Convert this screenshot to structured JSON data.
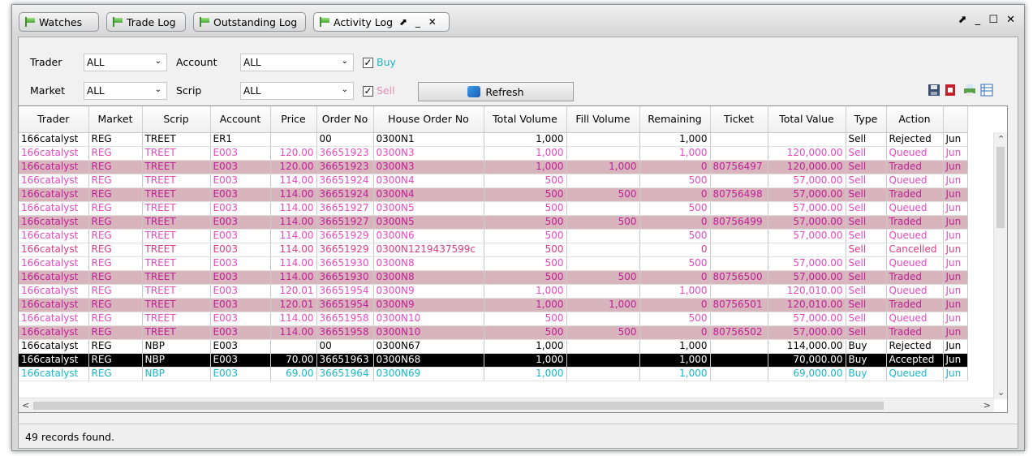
{
  "tabs": [
    {
      "label": "Watches"
    },
    {
      "label": "Trade Log"
    },
    {
      "label": "Outstanding Log"
    },
    {
      "label": "Activity Log"
    }
  ],
  "tab_controls": "⬈ _ ✕",
  "window_controls": "⬈ _ ☐ ✕",
  "filters": {
    "trader_label": "Trader",
    "trader_value": "ALL",
    "account_label": "Account",
    "account_value": "ALL",
    "market_label": "Market",
    "market_value": "ALL",
    "scrip_label": "Scrip",
    "scrip_value": "ALL",
    "buy_label": "Buy",
    "buy_checked": "✓",
    "sell_label": "Sell",
    "sell_checked": "✓",
    "refresh_label": "Refresh"
  },
  "grid": {
    "columns": [
      "Trader",
      "Market",
      "Scrip",
      "Account",
      "Price",
      "Order No",
      "House Order No",
      "Total Volume",
      "Fill Volume",
      "Remaining",
      "Ticket",
      "Total Value",
      "Type",
      "Action",
      ""
    ],
    "rows": [
      {
        "s": "rej",
        "c": [
          "166catalyst",
          "REG",
          "TREET",
          "ER1",
          "",
          "00",
          "0300N1",
          "1,000",
          "",
          "1,000",
          "",
          "",
          "Sell",
          "Rejected",
          "Jun"
        ]
      },
      {
        "s": "que",
        "c": [
          "166catalyst",
          "REG",
          "TREET",
          "E003",
          "120.00",
          "36651923",
          "0300N3",
          "1,000",
          "",
          "1,000",
          "",
          "120,000.00",
          "Sell",
          "Queued",
          "Jun"
        ]
      },
      {
        "s": "tra",
        "c": [
          "166catalyst",
          "REG",
          "TREET",
          "E003",
          "120.00",
          "36651923",
          "0300N3",
          "1,000",
          "1,000",
          "0",
          "80756497",
          "120,000.00",
          "Sell",
          "Traded",
          "Jun"
        ]
      },
      {
        "s": "que",
        "c": [
          "166catalyst",
          "REG",
          "TREET",
          "E003",
          "114.00",
          "36651924",
          "0300N4",
          "500",
          "",
          "500",
          "",
          "57,000.00",
          "Sell",
          "Queued",
          "Jun"
        ]
      },
      {
        "s": "tra",
        "c": [
          "166catalyst",
          "REG",
          "TREET",
          "E003",
          "114.00",
          "36651924",
          "0300N4",
          "500",
          "500",
          "0",
          "80756498",
          "57,000.00",
          "Sell",
          "Traded",
          "Jun"
        ]
      },
      {
        "s": "que",
        "c": [
          "166catalyst",
          "REG",
          "TREET",
          "E003",
          "114.00",
          "36651927",
          "0300N5",
          "500",
          "",
          "500",
          "",
          "57,000.00",
          "Sell",
          "Queued",
          "Jun"
        ]
      },
      {
        "s": "tra",
        "c": [
          "166catalyst",
          "REG",
          "TREET",
          "E003",
          "114.00",
          "36651927",
          "0300N5",
          "500",
          "500",
          "0",
          "80756499",
          "57,000.00",
          "Sell",
          "Traded",
          "Jun"
        ]
      },
      {
        "s": "que",
        "c": [
          "166catalyst",
          "REG",
          "TREET",
          "E003",
          "114.00",
          "36651929",
          "0300N6",
          "500",
          "",
          "500",
          "",
          "57,000.00",
          "Sell",
          "Queued",
          "Jun"
        ]
      },
      {
        "s": "can",
        "c": [
          "166catalyst",
          "REG",
          "TREET",
          "E003",
          "114.00",
          "36651929",
          "0300N1219437599c",
          "500",
          "",
          "0",
          "",
          "",
          "Sell",
          "Cancelled",
          "Jun"
        ]
      },
      {
        "s": "que",
        "c": [
          "166catalyst",
          "REG",
          "TREET",
          "E003",
          "114.00",
          "36651930",
          "0300N8",
          "500",
          "",
          "500",
          "",
          "57,000.00",
          "Sell",
          "Queued",
          "Jun"
        ]
      },
      {
        "s": "tra",
        "c": [
          "166catalyst",
          "REG",
          "TREET",
          "E003",
          "114.00",
          "36651930",
          "0300N8",
          "500",
          "500",
          "0",
          "80756500",
          "57,000.00",
          "Sell",
          "Traded",
          "Jun"
        ]
      },
      {
        "s": "que",
        "c": [
          "166catalyst",
          "REG",
          "TREET",
          "E003",
          "120.01",
          "36651954",
          "0300N9",
          "1,000",
          "",
          "1,000",
          "",
          "120,010.00",
          "Sell",
          "Queued",
          "Jun"
        ]
      },
      {
        "s": "tra",
        "c": [
          "166catalyst",
          "REG",
          "TREET",
          "E003",
          "120.01",
          "36651954",
          "0300N9",
          "1,000",
          "1,000",
          "0",
          "80756501",
          "120,010.00",
          "Sell",
          "Traded",
          "Jun"
        ]
      },
      {
        "s": "que",
        "c": [
          "166catalyst",
          "REG",
          "TREET",
          "E003",
          "114.00",
          "36651958",
          "0300N10",
          "500",
          "",
          "500",
          "",
          "57,000.00",
          "Sell",
          "Queued",
          "Jun"
        ]
      },
      {
        "s": "tra",
        "c": [
          "166catalyst",
          "REG",
          "TREET",
          "E003",
          "114.00",
          "36651958",
          "0300N10",
          "500",
          "500",
          "0",
          "80756502",
          "57,000.00",
          "Sell",
          "Traded",
          "Jun"
        ]
      },
      {
        "s": "rej",
        "c": [
          "166catalyst",
          "REG",
          "NBP",
          "E003",
          "",
          "00",
          "0300N67",
          "1,000",
          "",
          "1,000",
          "",
          "114,000.00",
          "Buy",
          "Rejected",
          "Jun"
        ]
      },
      {
        "s": "acc",
        "c": [
          "166catalyst",
          "REG",
          "NBP",
          "E003",
          "70.00",
          "36651963",
          "0300N68",
          "1,000",
          "",
          "1,000",
          "",
          "70,000.00",
          "Buy",
          "Accepted",
          "Jun"
        ]
      },
      {
        "s": "cyan",
        "c": [
          "166catalyst",
          "REG",
          "NBP",
          "E003",
          "69.00",
          "36651964",
          "0300N69",
          "1,000",
          "",
          "1,000",
          "",
          "69,000.00",
          "Buy",
          "Queued",
          "Jun"
        ]
      }
    ]
  },
  "status": "49 records found."
}
